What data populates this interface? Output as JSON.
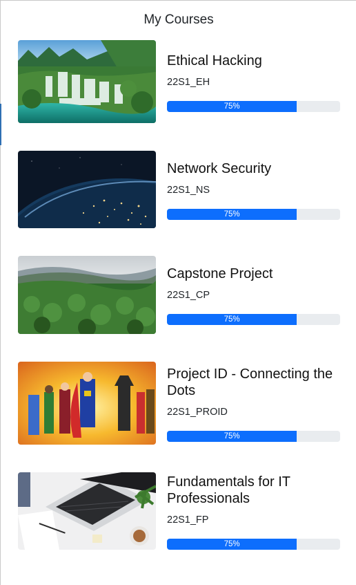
{
  "page_title": "My Courses",
  "colors": {
    "progress_fill": "#0d6efd",
    "progress_track": "#e9ecef"
  },
  "courses": [
    {
      "name": "Ethical Hacking",
      "code": "22S1_EH",
      "progress": 75,
      "progress_label": "75%",
      "image": "waterfall-landscape"
    },
    {
      "name": "Network Security",
      "code": "22S1_NS",
      "progress": 75,
      "progress_label": "75%",
      "image": "earth-from-space-night"
    },
    {
      "name": "Capstone Project",
      "code": "22S1_CP",
      "progress": 75,
      "progress_label": "75%",
      "image": "forest-valley"
    },
    {
      "name": "Project ID - Connecting the Dots",
      "code": "22S1_PROID",
      "progress": 75,
      "progress_label": "75%",
      "image": "superhero-team"
    },
    {
      "name": "Fundamentals for IT Professionals",
      "code": "22S1_FP",
      "progress": 75,
      "progress_label": "75%",
      "image": "laptop-workspace"
    }
  ]
}
